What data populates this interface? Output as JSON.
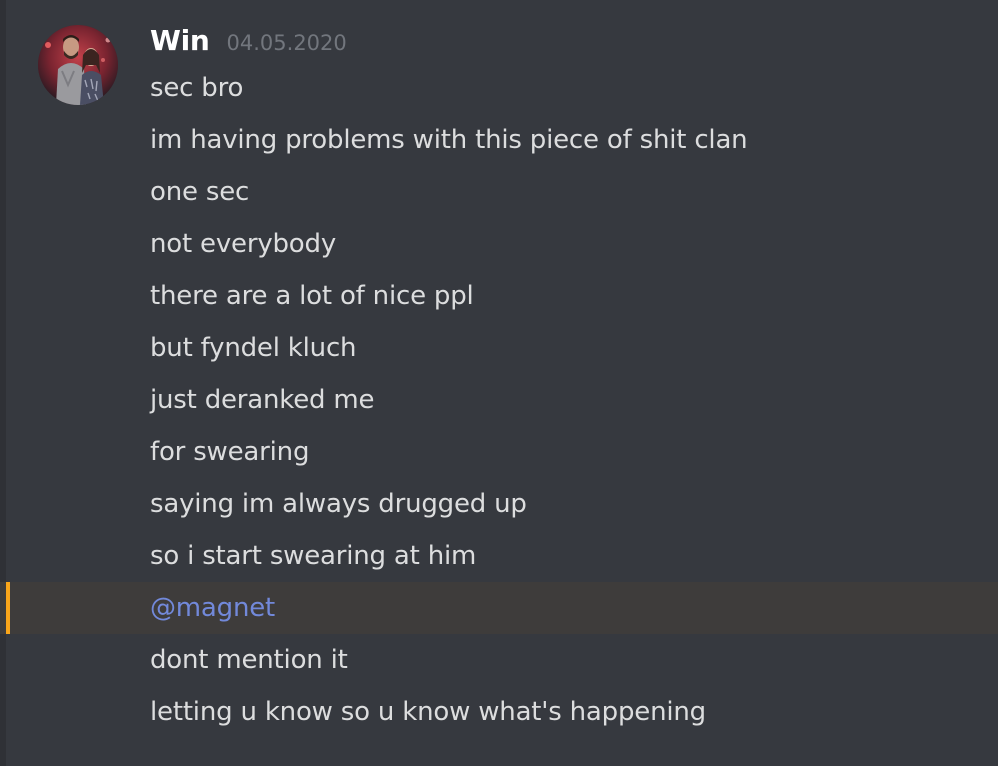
{
  "message_group": {
    "author": {
      "username": "Win",
      "timestamp": "04.05.2020"
    },
    "messages": [
      {
        "text": "sec bro"
      },
      {
        "text": "im having problems with this piece of shit clan"
      },
      {
        "text": "one sec"
      },
      {
        "text": "not everybody"
      },
      {
        "text": "there are a lot of nice ppl"
      },
      {
        "text": "but fyndel kluch"
      },
      {
        "text": "just deranked me"
      },
      {
        "text": "for swearing"
      },
      {
        "text": "saying im always drugged up"
      },
      {
        "text": "so i start swearing at him"
      },
      {
        "mention": "@magnet",
        "highlighted": true
      },
      {
        "text": "dont mention it"
      },
      {
        "text": "letting u know so u know what's happening"
      }
    ]
  },
  "colors": {
    "background": "#36393f",
    "message_text": "#dcddde",
    "username": "#ffffff",
    "timestamp": "#72767d",
    "mention": "#7289da",
    "mention_highlight_bg": "#3e3c3b",
    "mention_bar": "#faa61a"
  }
}
